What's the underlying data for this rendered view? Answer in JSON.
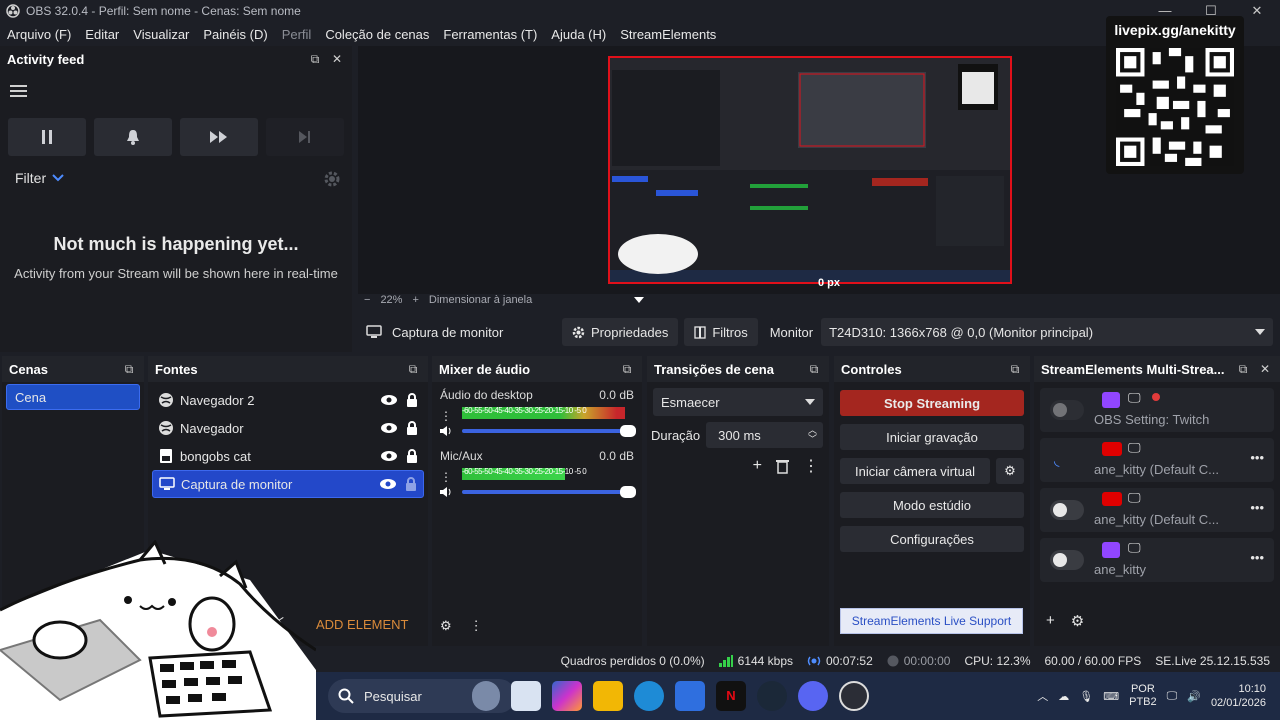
{
  "window": {
    "title": "OBS 32.0.4 - Perfil: Sem nome - Cenas: Sem nome",
    "ctrls": [
      "—",
      "☐",
      "✕"
    ]
  },
  "menu": [
    "Arquivo (F)",
    "Editar",
    "Visualizar",
    "Painéis (D)",
    "Perfil",
    "Coleção de cenas",
    "Ferramentas (T)",
    "Ajuda (H)",
    "StreamElements"
  ],
  "activity": {
    "title": "Activity feed",
    "filter": "Filter",
    "empty_title": "Not much is happening yet...",
    "empty_sub": "Activity from your Stream will be shown here in real-time"
  },
  "preview": {
    "qr_label": "livepix.gg/anekitty",
    "px_label": "0 px",
    "zoom": "22%",
    "fit_label": "Dimensionar à janela"
  },
  "source_toolbar": {
    "source_name": "Captura de monitor",
    "properties": "Propriedades",
    "filters": "Filtros",
    "monitor_label": "Monitor",
    "monitor_value": "T24D310: 1366x768 @ 0,0 (Monitor principal)"
  },
  "scenes": {
    "title": "Cenas",
    "items": [
      "Cena"
    ]
  },
  "sources": {
    "title": "Fontes",
    "items": [
      "Navegador 2",
      "Navegador",
      "bongobs cat",
      "Captura de monitor"
    ],
    "add_label": "ADD ELEMENT"
  },
  "mixer": {
    "title": "Mixer de áudio",
    "channels": [
      {
        "name": "Áudio do desktop",
        "db": "0.0 dB",
        "level": 0.95
      },
      {
        "name": "Mic/Aux",
        "db": "0.0 dB",
        "level": 0.6
      }
    ],
    "scale": "-60-55-50-45-40-35-30-25-20-15-10 -5 0"
  },
  "transitions": {
    "title": "Transições de cena",
    "selected": "Esmaecer",
    "duration_label": "Duração",
    "duration_value": "300 ms"
  },
  "controls": {
    "title": "Controles",
    "stop_streaming": "Stop Streaming",
    "start_recording": "Iniciar gravação",
    "virtual_cam": "Iniciar câmera virtual",
    "studio_mode": "Modo estúdio",
    "settings": "Configurações",
    "support": "StreamElements Live Support"
  },
  "multistream": {
    "title": "StreamElements Multi-Strea...",
    "rows": [
      {
        "name": "OBS Setting: Twitch",
        "platform": "twitch"
      },
      {
        "name": "ane_kitty (Default C...",
        "platform": "youtube"
      },
      {
        "name": "ane_kitty (Default C...",
        "platform": "youtube"
      },
      {
        "name": "ane_kitty",
        "platform": "twitch"
      }
    ]
  },
  "status": {
    "dropped": "Quadros perdidos 0 (0.0%)",
    "bitrate": "6144 kbps",
    "stream_time": "00:07:52",
    "rec_time": "00:00:00",
    "cpu": "CPU: 12.3%",
    "fps": "60.00 / 60.00 FPS",
    "version": "SE.Live 25.12.15.535"
  },
  "taskbar": {
    "search": "Pesquisar",
    "lang1": "POR",
    "lang2": "PTB2",
    "time": "10:10",
    "date": "02/01/2026"
  },
  "colors": {
    "accent": "#2348c9",
    "stream_red": "#a4261f",
    "twitch": "#9146ff",
    "youtube": "#e00000",
    "border_red": "#e0101a"
  }
}
